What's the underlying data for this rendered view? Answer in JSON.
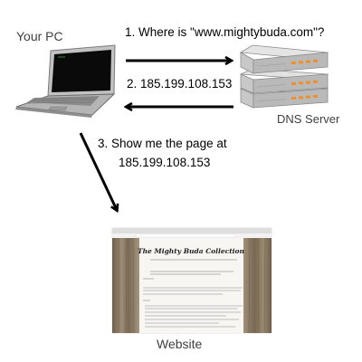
{
  "nodes": {
    "pc": {
      "label": "Your PC"
    },
    "dns": {
      "label": "DNS Server"
    },
    "website": {
      "label": "Website",
      "page_title": "The Mighty Buda Collection"
    }
  },
  "steps": [
    {
      "label": "1. Where is \"www.mightybuda.com\"?"
    },
    {
      "label": "2. 185.199.108.153"
    },
    {
      "label_line1": "3. Show me the page at",
      "label_line2": "185.199.108.153"
    }
  ],
  "colors": {
    "text": "#404040",
    "arrow": "#000000",
    "server_body": "#d4d4d4",
    "server_front": "#bfbfbf",
    "server_light": "#f0902a",
    "laptop_body": "#b5b5b5",
    "laptop_screen": "#0a0a0a",
    "wood": "#8a7a65",
    "page_bg": "#f7f6f2"
  },
  "icons": [
    "laptop-icon",
    "server-icon",
    "website-screenshot"
  ]
}
